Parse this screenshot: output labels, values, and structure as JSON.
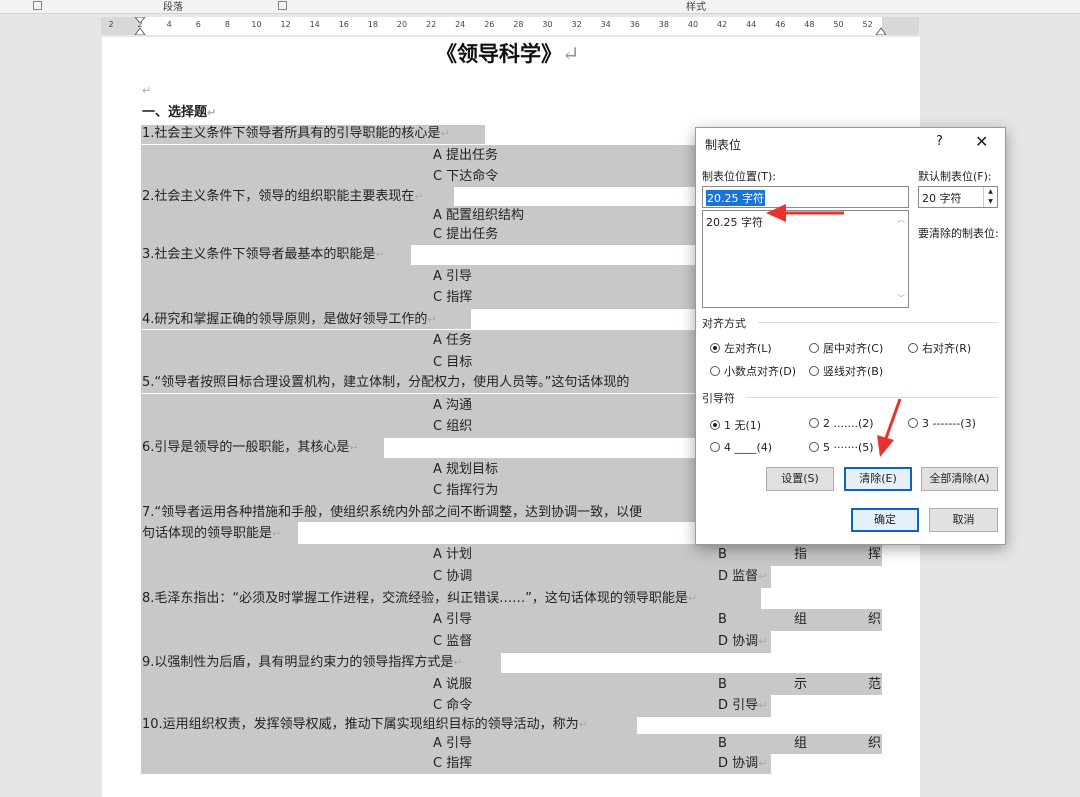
{
  "ribbon": {
    "paragraph_group": "段落",
    "styles_group": "样式"
  },
  "ruler": {
    "ticks": [
      "2",
      "2",
      "4",
      "6",
      "8",
      "10",
      "12",
      "14",
      "16",
      "18",
      "20",
      "22",
      "24",
      "26",
      "28",
      "30",
      "32",
      "34",
      "36",
      "38",
      "40",
      "42",
      "44",
      "46",
      "48",
      "50",
      "52"
    ]
  },
  "document": {
    "title": "《领导科学》",
    "pilcrow": "↵",
    "section_heading": "一、选择题",
    "q1": "1.社会主义条件下领导者所具有的引导职能的核心是",
    "q1_a": "A 提出任务",
    "q1_c": "C 下达命令",
    "q2": "2.社会主义条件下，领导的组织职能主要表现在",
    "q2_a": "A 配置组织结构",
    "q2_c": "C 提出任务",
    "q3": "3.社会主义条件下领导者最基本的职能是",
    "q3_a": "A 引导",
    "q3_c": "C 指挥",
    "q4": "4.研究和掌握正确的领导原则，是做好领导工作的",
    "q4_a": "A 任务",
    "q4_c": "C 目标",
    "q5": "5.“领导者按照目标合理设置机构，建立体制，分配权力，使用人员等。”这句话体现的",
    "q5_a": "A 沟通",
    "q5_c": "C 组织",
    "q6": "6.引导是领导的一般职能，其核心是",
    "q6_a": "A 规划目标",
    "q6_c": "C 指挥行为",
    "q7_line1": "7.“领导者运用各种措施和手般，使组织系统内外部之间不断调整，达到协调一致，以便",
    "q7_line2": "句话体现的领导职能是",
    "q7_a": "A 计划",
    "q7_b": "B",
    "q7_b_word": [
      "指",
      "挥"
    ],
    "q7_c": "C 协调",
    "q7_d": "D 监督",
    "q8": "8.毛泽东指出：“必须及时掌握工作进程，交流经验，纠正错误……”，这句话体现的领导职能是",
    "q8_a": "A 引导",
    "q8_b": "B",
    "q8_b_word": [
      "组",
      "织"
    ],
    "q8_c": "C 监督",
    "q8_d": "D 协调",
    "q9": "9.以强制性为后盾，具有明显约束力的领导指挥方式是",
    "q9_a": "A 说服",
    "q9_b": "B",
    "q9_b_word": [
      "示",
      "范"
    ],
    "q9_c": "C 命令",
    "q9_d": "D 引导",
    "q10": "10.运用组织权责，发挥领导权威，推动下属实现组织目标的领导活动，称为",
    "q10_a": "A 引导",
    "q10_b": "B",
    "q10_b_word": [
      "组",
      "织"
    ],
    "q10_c": "C 指挥",
    "q10_d": "D 协调"
  },
  "dialog": {
    "title": "制表位",
    "help": "?",
    "close": "✕",
    "tab_stop_position_label": "制表位位置(T):",
    "tab_stop_position_value": "20.25 字符",
    "tab_list": [
      "20.25 字符"
    ],
    "default_tab_label": "默认制表位(F):",
    "default_tab_value": "20 字符",
    "to_clear_label": "要清除的制表位:",
    "alignment_label": "对齐方式",
    "align_left": "左对齐(L)",
    "align_center": "居中对齐(C)",
    "align_right": "右对齐(R)",
    "align_decimal": "小数点对齐(D)",
    "align_bar": "竖线对齐(B)",
    "leader_label": "引导符",
    "leader_1": "1 无(1)",
    "leader_2": "2 .......(2)",
    "leader_3": "3 -------(3)",
    "leader_4": "4 ____(4)",
    "leader_5": "5 ·······(5)",
    "set_button": "设置(S)",
    "clear_button": "清除(E)",
    "clear_all_button": "全部清除(A)",
    "ok_button": "确定",
    "cancel_button": "取消"
  },
  "colors": {
    "selection": "#c8c8c8",
    "annotation_arrow": "#e8322b",
    "focus_blue": "#0a64c8"
  }
}
